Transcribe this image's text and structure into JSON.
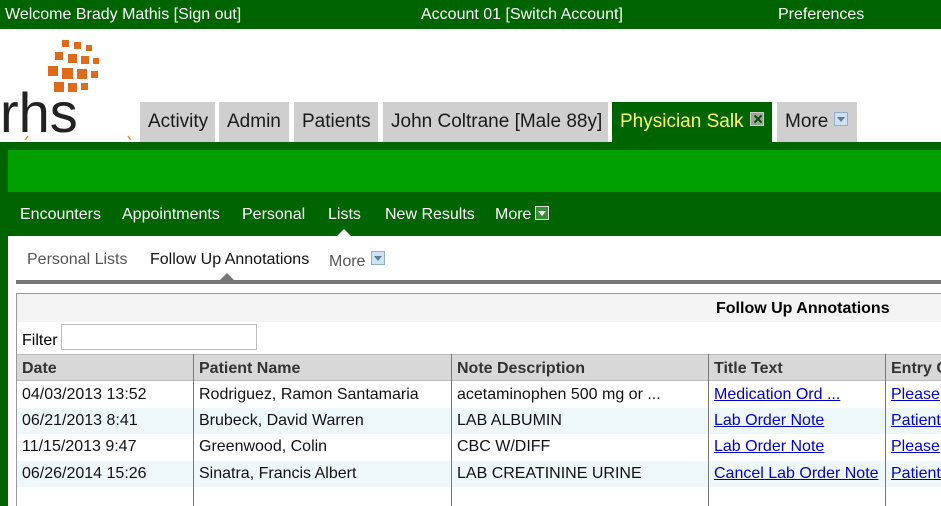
{
  "topbar": {
    "welcome": "Welcome Brady Mathis [Sign out]",
    "account": "Account 01 [Switch Account]",
    "preferences": "Preferences"
  },
  "main_tabs": [
    {
      "label": "Activity"
    },
    {
      "label": "Admin"
    },
    {
      "label": "Patients"
    },
    {
      "label": "John Coltrane [Male 88y]"
    },
    {
      "label": "Physician Salk",
      "active": true
    },
    {
      "label": "More"
    }
  ],
  "sub_nav": [
    {
      "label": "Encounters"
    },
    {
      "label": "Appointments"
    },
    {
      "label": "Personal"
    },
    {
      "label": "Lists",
      "active": true
    },
    {
      "label": "New Results"
    },
    {
      "label": "More"
    }
  ],
  "sub_sub_nav": [
    {
      "label": "Personal Lists"
    },
    {
      "label": "Follow Up Annotations",
      "active": true
    },
    {
      "label": "More"
    }
  ],
  "panel": {
    "title": "Follow Up Annotations",
    "filter_label": "Filter",
    "filter_value": ""
  },
  "table": {
    "columns": [
      "Date",
      "Patient Name",
      "Note Description",
      "Title Text",
      "Entry C"
    ],
    "rows": [
      {
        "date": "04/03/2013 13:52",
        "patient": "Rodriguez, Ramon Santamaria",
        "note": "acetaminophen 500 mg or ...",
        "title": "Medication Ord ...",
        "entry": "Please"
      },
      {
        "date": "06/21/2013 8:41",
        "patient": "Brubeck, David Warren",
        "note": "LAB ALBUMIN",
        "title": "Lab Order Note",
        "entry": "Patient"
      },
      {
        "date": "11/15/2013 9:47",
        "patient": "Greenwood, Colin",
        "note": "CBC W/DIFF",
        "title": "Lab Order Note",
        "entry": "Please"
      },
      {
        "date": "06/26/2014 15:26",
        "patient": "Sinatra, Francis Albert",
        "note": "LAB CREATININE URINE",
        "title": "Cancel Lab Order Note",
        "entry": "Patient"
      }
    ]
  },
  "colors": {
    "dark_green": "#006400",
    "bright_green": "#00a000",
    "active_tab_text": "#ffff66",
    "link_blue": "#0000cc",
    "logo_orange": "#e06a1b"
  },
  "icons": {
    "close_tab": "close-icon",
    "dropdown": "chevron-down-icon"
  }
}
